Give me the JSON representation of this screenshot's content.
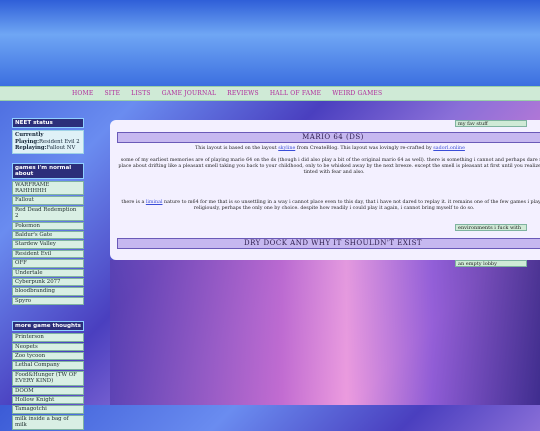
{
  "nav": {
    "items": [
      "HOME",
      "SITE",
      "LISTS",
      "GAME JOURNAL",
      "REVIEWS",
      "HALL OF FAME",
      "WEIRD GAMES"
    ]
  },
  "status": {
    "title": "NEET status",
    "playing_label": "Currently Playing:",
    "playing_value": "Resident Evil 2",
    "replaying_label": "Replaying:",
    "replaying_value": "Fallout NV"
  },
  "normal_games": {
    "title": "games i'm normal about",
    "items": [
      "WARFRAME RAHHHHH",
      "Fallout",
      "Red Dead Redemption 2",
      "Pokemon",
      "Baldur's Gate",
      "Stardew Valley",
      "Resident Evil",
      "OFF",
      "Undertale",
      "Cyberpunk 2077",
      "bloodbranding",
      "Spyro"
    ]
  },
  "more_games": {
    "title": "more game thoughts",
    "items": [
      "Printerson",
      "Neopets",
      "Zoo tycoon",
      "Lethal Company",
      "Food&Hunger (TW OF EVERY KIND)",
      "DOOM",
      "Hollow Knight",
      "Tamagotchi",
      "milk inside a bag of milk"
    ]
  },
  "post": {
    "title": "MARIO 64 (DS)",
    "credit_prefix": "This layout is based on the layout",
    "credit_link1": "skyline",
    "credit_mid": "from CreateBlog. This layout was lovingly re-crafted by",
    "credit_link2": "sadorl.online",
    "para1": "some of my earliest memories are of playing mario 64 on the ds (though i did also play a bit of the original mario 64 as well). there is something i cannot and perhaps dare not place about drifting like a pleasant smell taking you back to your childhood, only to be whisked away by the next breeze. except the smell is pleasant at first until you realize it's tinted with fear and also.",
    "para2_prefix": "there is a",
    "para2_link": "liminal",
    "para2_rest": "nature to m64 for me that is so unsettling in a way i cannot place even to this day, that i have not dared to replay it. it remains one of the few games i played religiously, perhaps the only one by choice. despite how readily i could play it again, i cannot bring myself to do so."
  },
  "post2": {
    "title": "DRY DOCK AND WHY IT SHOULDN'T EXIST"
  },
  "right": {
    "widget1": "my fav stuff",
    "widget2": "environments i fuck with",
    "widget3": "an empty lobby"
  }
}
